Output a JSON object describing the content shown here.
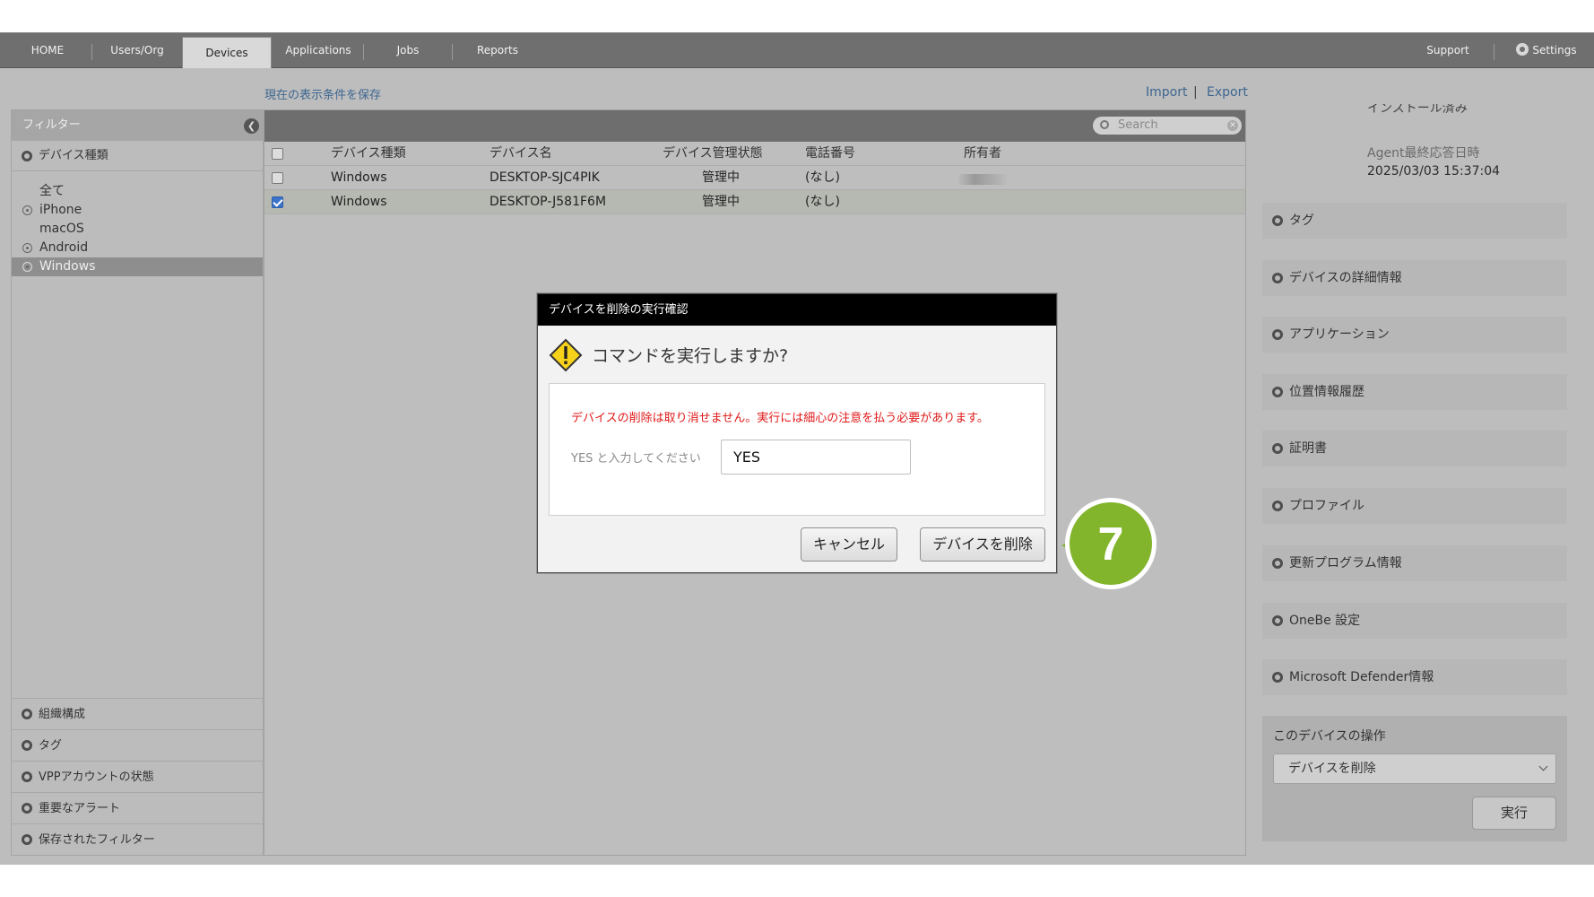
{
  "nav": {
    "home": "HOME",
    "users": "Users/Org",
    "devices": "Devices",
    "applications": "Applications",
    "jobs": "Jobs",
    "reports": "Reports",
    "support": "Support",
    "settings": "Settings"
  },
  "toolbar_links": {
    "save_view": "現在の表示条件を保存",
    "import": "Import",
    "separator": "|",
    "export": "Export"
  },
  "sidebar": {
    "header": "フィルター",
    "device_type": "デバイス種類",
    "types": [
      {
        "label": "全て"
      },
      {
        "label": "iPhone"
      },
      {
        "label": "macOS"
      },
      {
        "label": "Android"
      },
      {
        "label": "Windows"
      }
    ],
    "bottom_sections": [
      "組織構成",
      "タグ",
      "VPPアカウントの状態",
      "重要なアラート",
      "保存されたフィルター"
    ]
  },
  "search": {
    "placeholder": "Search"
  },
  "table": {
    "headers": [
      "デバイス種類",
      "デバイス名",
      "デバイス管理状態",
      "電話番号",
      "所有者"
    ],
    "rows": [
      {
        "type": "Windows",
        "name": "DESKTOP-SJC4PIK",
        "status": "管理中",
        "phone": "(なし)",
        "owner": "",
        "checked": false
      },
      {
        "type": "Windows",
        "name": "DESKTOP-J581F6M",
        "status": "管理中",
        "phone": "(なし)",
        "owner": "",
        "checked": true
      }
    ]
  },
  "right_panel": {
    "installed": "インストール済み",
    "agent_label": "Agent最終応答日時",
    "agent_value": "2025/03/03 15:37:04",
    "sections": [
      "タグ",
      "デバイスの詳細情報",
      "アプリケーション",
      "位置情報履歴",
      "証明書",
      "プロファイル",
      "更新プログラム情報",
      "OneBe 設定",
      "Microsoft Defender情報"
    ],
    "ops_label": "このデバイスの操作",
    "ops_selected": "デバイスを削除",
    "ops_button": "実行"
  },
  "modal": {
    "title": "デバイスを削除の実行確認",
    "question": "コマンドを実行しますか?",
    "warning": "デバイスの削除は取り消せません。実行には細心の注意を払う必要があります。",
    "prompt": "YES と入力してください",
    "input_value": "YES",
    "cancel": "キャンセル",
    "confirm": "デバイスを削除"
  },
  "step": {
    "number": "7",
    "color": "#82b52b"
  },
  "colors": {
    "nav": "#6f6f6f",
    "link": "#3d6690",
    "warning_text": "#e01818",
    "checkbox": "#3a73c9"
  }
}
